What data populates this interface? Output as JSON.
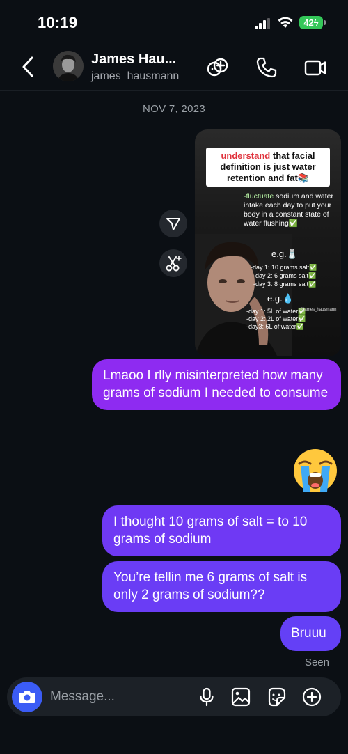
{
  "status": {
    "time": "10:19",
    "battery": "42"
  },
  "header": {
    "name": "James Hau...",
    "username": "james_hausmann"
  },
  "date": "NOV 7, 2023",
  "shared_post": {
    "caption_red": "understand",
    "caption_rest": " that facial definition is just water retention and fat📚",
    "tip_green": "-fluctuate",
    "tip_rest": " sodium and water intake each day to put your body in a constant state of water flushing✅",
    "salt_header": "e.g.🧂",
    "salt_days": [
      "-day 1: 10 grams salt✅",
      "-day 2: 6 grams salt✅",
      "-day 3: 8 grams salt✅"
    ],
    "water_header": "e.g.💧",
    "water_days": [
      "-day 1: 5L of water✅",
      "-day 2: 2L of water✅",
      "-day3: 6L of water✅"
    ],
    "handle": "@james_hausmann"
  },
  "messages": [
    {
      "text": "Lmaoo I rlly misinterpreted how many grams of sodium I needed to consume"
    },
    {
      "emoji": "😭"
    },
    {
      "text": "I thought 10 grams of salt = to 10 grams of sodium"
    },
    {
      "text": "You’re tellin me 6 grams of salt is only 2 grams of sodium??"
    },
    {
      "text": "Bruuu"
    }
  ],
  "seen_label": "Seen",
  "composer": {
    "placeholder": "Message..."
  },
  "colors": {
    "background": "#0b0f14",
    "bubble": "#7234f0",
    "camera": "#3b5cf5"
  }
}
